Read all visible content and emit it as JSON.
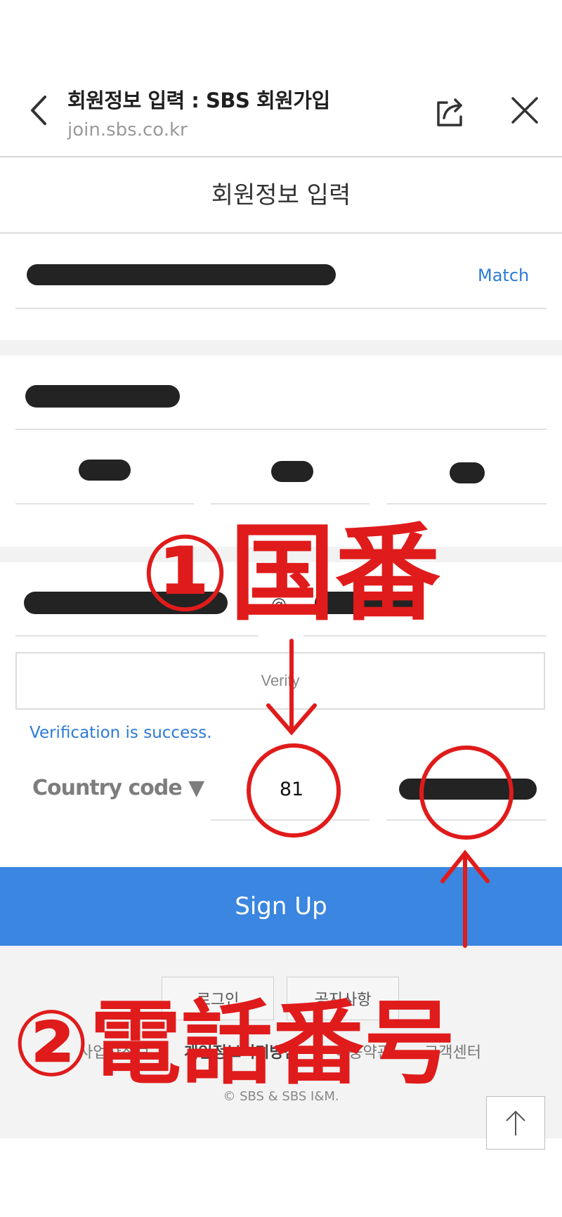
{
  "browser": {
    "title": "회원정보 입력 : SBS 회원가입",
    "url": "join.sbs.co.kr"
  },
  "form": {
    "section_title": "회원정보 입력",
    "password_confirm_status": "Match",
    "email_at": "@",
    "verify_label": "Verify",
    "verify_message": "Verification is success.",
    "country_code_label": "Country code ▼",
    "country_code_value": "81",
    "signup_label": "Sign Up"
  },
  "footer": {
    "buttons": [
      "로그인",
      "공지사항"
    ],
    "links": [
      "사업자정보",
      "개인정보처리방침",
      "이용약관",
      "고객센터"
    ],
    "copyright": "© SBS & SBS I&M."
  },
  "annotations": {
    "label_1": "①国番",
    "label_2": "②電話番号",
    "color": "#e01b1b"
  },
  "colors": {
    "accent": "#3a86e0",
    "link": "#2d7bd6",
    "redaction": "#232323"
  }
}
